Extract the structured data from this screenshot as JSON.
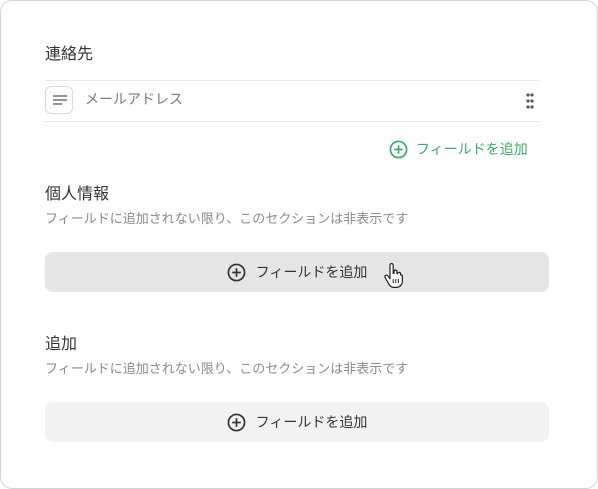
{
  "contact": {
    "title": "連絡先",
    "fields": [
      {
        "label": "メールアドレス",
        "icon": "text-lines-icon"
      }
    ],
    "add_field_label": "フィールドを追加"
  },
  "personal": {
    "title": "個人情報",
    "description": "フィールドに追加されない限り、このセクションは非表示です",
    "add_field_label": "フィールドを追加"
  },
  "additional": {
    "title": "追加",
    "description": "フィールドに追加されない限り、このセクションは非表示です",
    "add_field_label": "フィールドを追加"
  },
  "colors": {
    "accent": "#3daa6b",
    "button_bg": "#f2f2f2",
    "button_hover_bg": "#e5e5e5"
  }
}
